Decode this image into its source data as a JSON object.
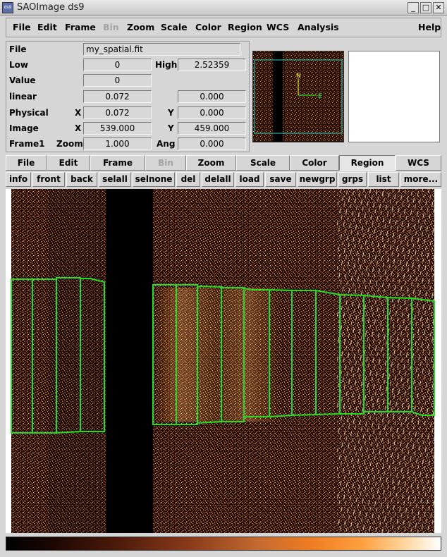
{
  "window": {
    "title": "SAOImage ds9",
    "icon_label": "ds9",
    "minimize_icon": "minimize-icon",
    "maximize_icon": "maximize-icon",
    "close_icon": "close-icon"
  },
  "menubar": {
    "items": [
      "File",
      "Edit",
      "Frame",
      "Bin",
      "Zoom",
      "Scale",
      "Color",
      "Region",
      "WCS",
      "Analysis"
    ],
    "help": "Help",
    "disabled": [
      "Bin"
    ]
  },
  "info": {
    "file_label": "File",
    "file_value": "my_spatial.fit",
    "low_label": "Low",
    "low_value": "0",
    "high_label": "High",
    "high_value": "2.52359",
    "value_label": "Value",
    "value_value": "0",
    "scale_label": "linear",
    "scale_value1": "0.072",
    "scale_value2": "0.000",
    "physical_label": "Physical",
    "physical_x_label": "X",
    "physical_x": "0.072",
    "physical_y_label": "Y",
    "physical_y": "0.000",
    "image_label": "Image",
    "image_x_label": "X",
    "image_x": "539.000",
    "image_y_label": "Y",
    "image_y": "459.000",
    "frame_label": "Frame1",
    "zoom_label": "Zoom",
    "zoom_value": "1.000",
    "angle_label": "Ang",
    "angle_value": "0.000"
  },
  "panner": {
    "compass_north": "N",
    "compass_east": "E"
  },
  "buttonbar": {
    "items": [
      "File",
      "Edit",
      "Frame",
      "Bin",
      "Zoom",
      "Scale",
      "Color",
      "Region",
      "WCS"
    ],
    "active": "Region",
    "disabled": [
      "Bin"
    ]
  },
  "region_buttons": {
    "items": [
      "info",
      "front",
      "back",
      "selall",
      "selnone",
      "del",
      "delall",
      "load",
      "save",
      "newgrp",
      "grps",
      "list",
      "more..."
    ]
  },
  "colors": {
    "region_outline": "#22dd22",
    "colormap_low": "#000000",
    "colormap_mid": "#ee7b20",
    "colormap_high": "#ffffff"
  }
}
